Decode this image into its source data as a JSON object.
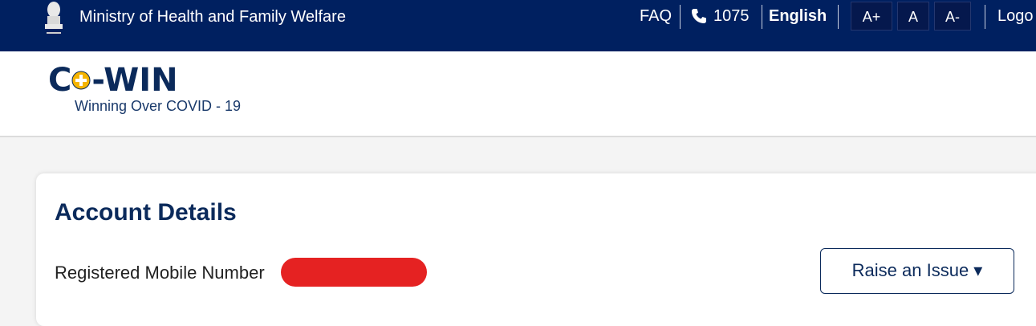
{
  "topbar": {
    "ministry": "Ministry of Health and Family Welfare",
    "faq": "FAQ",
    "phone": "1075",
    "language": "English",
    "font_increase": "A+",
    "font_normal": "A",
    "font_decrease": "A-",
    "logout": "Logo"
  },
  "header": {
    "logo_left": "C",
    "logo_right": "-WIN",
    "tagline": "Winning Over COVID - 19"
  },
  "account": {
    "title": "Account Details",
    "mobile_label": "Registered Mobile Number",
    "raise_issue": "Raise an Issue ▾"
  },
  "colors": {
    "topbar": "#002060",
    "brand_text": "#0b2a5b",
    "redaction": "#e52222",
    "logo_plus": "#f5b400"
  },
  "icons": [
    "emblem-icon",
    "phone-icon",
    "plus-circle-icon"
  ]
}
